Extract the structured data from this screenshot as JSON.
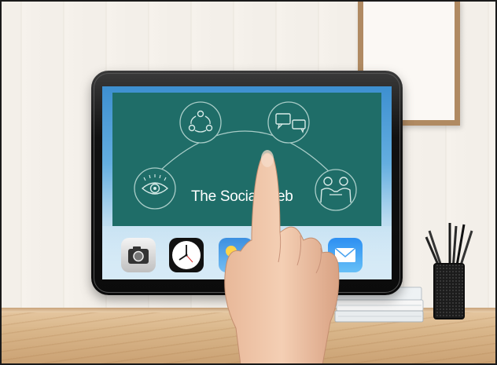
{
  "slide": {
    "title": "The Social Web",
    "background_color": "#1f6d68",
    "icons": [
      "share-network-icon",
      "chat-bubbles-icon",
      "eye-icon",
      "people-meeting-icon"
    ]
  },
  "dock": {
    "apps": [
      "camera-app-icon",
      "clock-app-icon",
      "weather-app-icon",
      "photos-app-icon",
      "mail-app-icon"
    ]
  },
  "scene": {
    "objects": [
      "tablet",
      "pointing-hand",
      "picture-frame",
      "books",
      "pencil-cup",
      "wooden-desk"
    ]
  }
}
